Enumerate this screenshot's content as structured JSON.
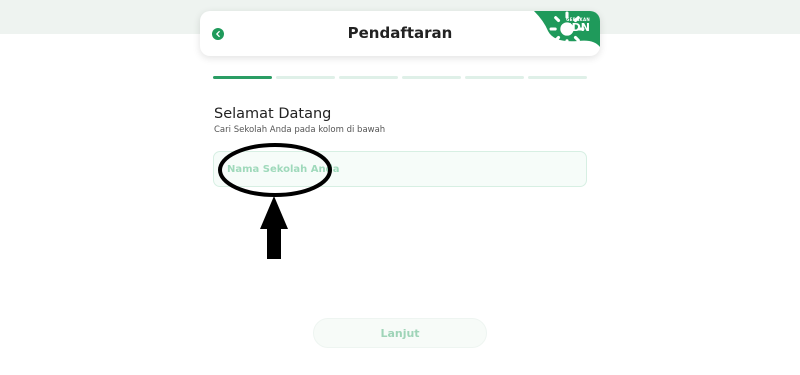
{
  "header": {
    "title": "Pendaftaran",
    "back_icon": "chevron-left-icon",
    "brand": {
      "small": "GERAKAN",
      "big": "IDN",
      "icon": "sun-icon",
      "color": "#1f9a5b"
    }
  },
  "progress": {
    "total_steps": 6,
    "current_step": 1,
    "active_color": "#2a9d64",
    "inactive_color": "#dff0e8"
  },
  "welcome": {
    "title": "Selamat Datang",
    "subtitle": "Cari Sekolah Anda pada kolom di bawah"
  },
  "school_search": {
    "placeholder": "Nama Sekolah Anda",
    "value": ""
  },
  "footer": {
    "next_label": "Lanjut"
  },
  "annotation": {
    "shape": "ellipse-highlight",
    "pointer": "arrow-up-icon"
  }
}
